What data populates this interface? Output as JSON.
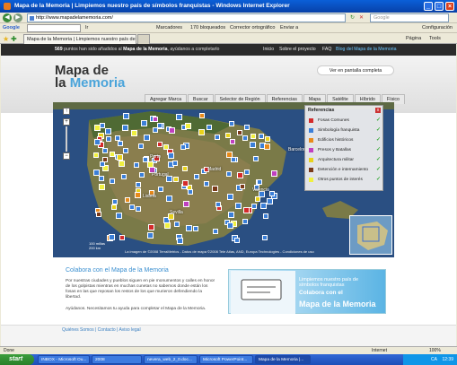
{
  "window": {
    "title": "Mapa de la Memoria | Limpiemos nuestro país de símbolos franquistas - Windows Internet Explorer"
  },
  "address": {
    "url": "http://www.mapadelamemoria.com/",
    "search_placeholder": "Google"
  },
  "toolbar": {
    "google": "Google",
    "items": [
      "Ir",
      "Marcadores",
      "170 bloqueados",
      "Corrector ortográfico",
      "Enviar a",
      "Configuración"
    ]
  },
  "tabs": [
    "Mapa de la Memoria | Limpiemos nuestro país de símb...",
    ""
  ],
  "tab_tools": [
    "Página",
    "Tools"
  ],
  "site": {
    "notice_count": "569",
    "notice_text": " puntos han sido añadidos al ",
    "notice_brand": "Mapa de la Memoria",
    "notice_end": ", ayúdanos a completarlo",
    "nav": [
      "Inicio",
      "Sobre el proyecto",
      "FAQ",
      "Blog del Mapa de la Memoria"
    ],
    "logo_line1": "Mapa de",
    "logo_line2a": "la ",
    "logo_line2b": "Memoria",
    "fullscreen_btn": "Ver en pantalla completa",
    "map_tabs": [
      "Agregar Marca",
      "Buscar",
      "Selector de Región",
      "Referencias",
      "Mapa",
      "Satélite",
      "Híbrido",
      "Físico"
    ]
  },
  "legend": {
    "title": "Referencias",
    "close": "x",
    "items": [
      {
        "label": "Fosas Comunes",
        "color": "#d42a2a"
      },
      {
        "label": "Simbología franquista",
        "color": "#3b7fd8"
      },
      {
        "label": "Edificios históricos",
        "color": "#e88a1a"
      },
      {
        "label": "Presos y Batallas",
        "color": "#c03fc0"
      },
      {
        "label": "Arquitectura militar",
        "color": "#e8d21a"
      },
      {
        "label": "Detención e internamiento",
        "color": "#7a3a1a"
      },
      {
        "label": "Otros puntos de interés",
        "color": "#f0f040"
      }
    ]
  },
  "map": {
    "places": [
      "Portugal",
      "Porto",
      "Lisboa",
      "Madrid",
      "Barcelona",
      "Valencia",
      "Sevilla"
    ],
    "copyright": "La imagen de ©2008 TerraMetrics - Datos de mapa ©2008 Tele Atlas, AND, Europa Technologies - Condiciones de uso",
    "scale_mi": "100 millas",
    "scale_km": "200 km"
  },
  "lower": {
    "title": "Colabora con el Mapa de la Memoria",
    "body": "Por nuestras ciudades y pueblos siguen en pie monumentos y calles en honor de los golpistas mientras en muchas cunetas no sabemos donde están los fosas en las que reposan los restos de los que murieron defendiendo la libertad.",
    "help": "Ayúdanos. Necesitamos tu ayuda para completar el Mapa de la Memoria.",
    "banner_line1": "Limpiemos nuestro país de",
    "banner_line1b": "símbolos franquistas",
    "banner_line2": "Colabora con el",
    "banner_line3": "Mapa de la Memoria",
    "footer_links": "Quiénes Somos | Contacto | Aviso legal"
  },
  "statusbar": {
    "left": "Done",
    "zone": "Internet",
    "zoom": "100%"
  },
  "taskbar": {
    "start": "start",
    "items": [
      "INBOX - Microsoft Ou...",
      "2008",
      "nevera_web_2_0.doc...",
      "Microsoft PowerPoint...",
      "Mapa de la Memoria |..."
    ],
    "lang": "CA",
    "time": "12:39"
  }
}
